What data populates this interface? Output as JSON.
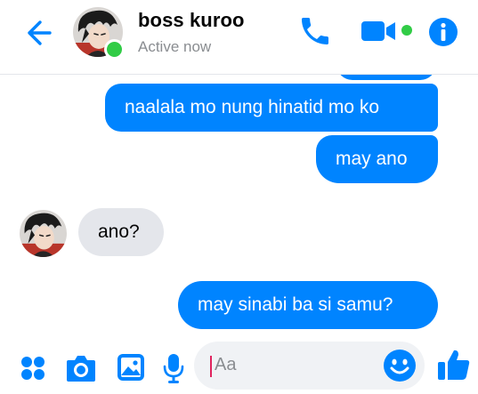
{
  "header": {
    "contact_name": "boss kuroo",
    "status": "Active now"
  },
  "messages": [
    {
      "direction": "outgoing",
      "text": ""
    },
    {
      "direction": "outgoing",
      "text": "naalala mo nung hinatid mo ko"
    },
    {
      "direction": "outgoing",
      "text": "may ano"
    },
    {
      "direction": "incoming",
      "text": "ano?"
    },
    {
      "direction": "outgoing",
      "text": "may sinabi ba si samu?"
    }
  ],
  "composer": {
    "placeholder": "Aa"
  },
  "colors": {
    "accent": "#0084ff",
    "outgoing_bubble": "#0084ff",
    "incoming_bubble": "#e4e6eb",
    "online": "#31cc46",
    "caret": "#e0245e"
  },
  "icons": {
    "back": "arrow-left-icon",
    "call": "phone-icon",
    "video": "video-camera-icon",
    "info": "info-icon",
    "more": "four-dots-icon",
    "camera": "camera-icon",
    "gallery": "image-icon",
    "mic": "microphone-icon",
    "emoji": "smiley-icon",
    "like": "thumbs-up-icon"
  }
}
